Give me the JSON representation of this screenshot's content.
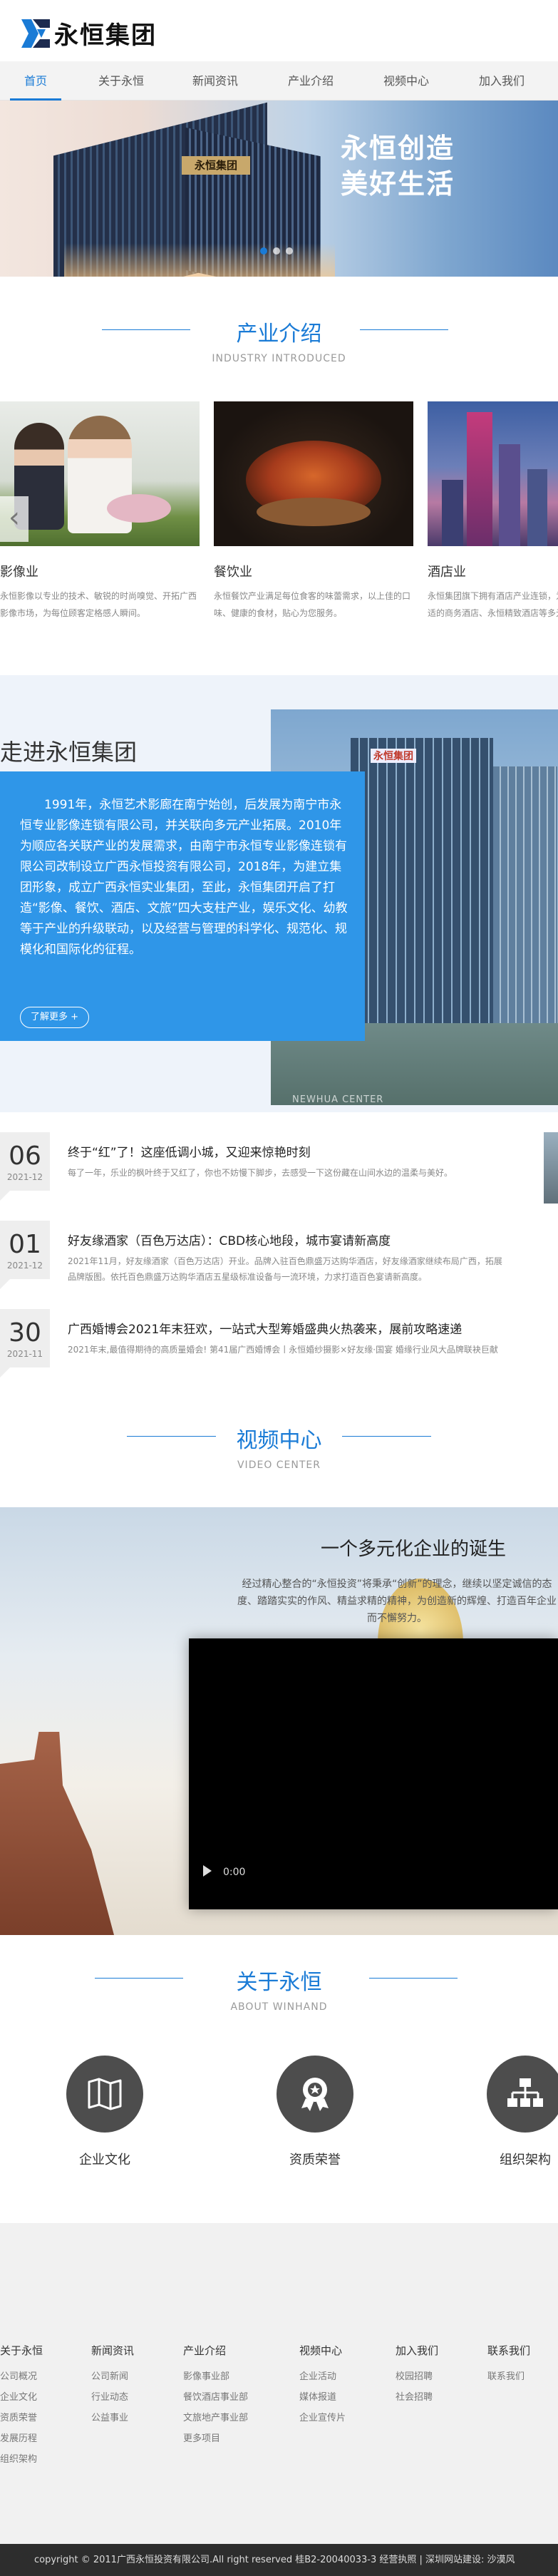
{
  "header": {
    "logo_text": "永恒集团"
  },
  "nav": {
    "items": [
      {
        "label": "首页",
        "active": true
      },
      {
        "label": "关于永恒"
      },
      {
        "label": "新闻资讯"
      },
      {
        "label": "产业介绍"
      },
      {
        "label": "视频中心"
      },
      {
        "label": "加入我们"
      }
    ]
  },
  "banner": {
    "slogan_line1": "永恒创造",
    "slogan_line2": "美好生活",
    "building_sign": "永恒集团",
    "slides": 3,
    "active_slide": 1
  },
  "industry": {
    "title": "产业介绍",
    "subtitle": "INDUSTRY INTRODUCED",
    "items": [
      {
        "name": "影像业",
        "desc": "永恒影像以专业的技术、敏锐的时尚嗅觉、开拓广西影像市场，为每位顾客定格感人瞬间。"
      },
      {
        "name": "餐饮业",
        "desc": "永恒餐饮产业满足每位食客的味蕾需求，以上佳的口味、健康的食材，贴心为您服务。"
      },
      {
        "name": "酒店业",
        "desc": "永恒集团旗下拥有酒店产业连锁，为宾客提供豪华舒适的商务酒店、永恒精致酒店等多元化住宿体验。"
      }
    ],
    "prev_arrow": "‹"
  },
  "intro": {
    "title": "走进永恒集团",
    "text": "1991年，永恒艺术影廊在南宁始创，后发展为南宁市永恒专业影像连锁有限公司，并关联向多元产业拓展。2010年为顺应各关联产业的发展需求，由南宁市永恒专业影像连锁有限公司改制设立广西永恒投资有限公司，2018年，为建立集团形象，成立广西永恒实业集团，至此，永恒集团开启了打造“影像、餐饮、酒店、文旅”四大支柱产业，娱乐文化、幼教等于产业的升级联动，以及经营与管理的科学化、规范化、规模化和国际化的征程。",
    "more": "了解更多 +",
    "photo_caption": "NEWHUA CENTER",
    "building_sign": "永恒集团"
  },
  "news": [
    {
      "day": "06",
      "ym": "2021-12",
      "title": "终于“红”了！这座低调小城，又迎来惊艳时刻",
      "desc": "每了一年，乐业的枫叶终于又红了，你也不妨慢下脚步，去感受一下这份藏在山间水边的温柔与美好。"
    },
    {
      "day": "01",
      "ym": "2021-12",
      "title": "好友缘酒家（百色万达店）：CBD核心地段，城市宴请新高度",
      "desc": "2021年11月，好友缘酒家（百色万达店）开业。品牌入驻百色鼎盛万达购华酒店，好友缘酒家继续布局广西，拓展品牌版图。依托百色鼎盛万达购华酒店五星级标准设备与一流环境，力求打造百色宴请新高度。"
    },
    {
      "day": "30",
      "ym": "2021-11",
      "title": "广西婚博会2021年末狂欢，一站式大型筹婚盛典火热袭来，展前攻略速递",
      "desc": "2021年末,最值得期待的高质量婚会! 第41届广西婚博会丨永恒婚纱摄影×好友缘·国宴 婚缘行业风大品牌联袂巨献"
    }
  ],
  "video": {
    "title": "视频中心",
    "subtitle": "VIDEO CENTER",
    "headline": "一个多元化企业的诞生",
    "desc": "经过精心整合的“永恒投资”将秉承“创新”的理念，继续以坚定诚信的态度、踏踏实实的作风、精益求精的精神，为创造新的辉煌、打造百年企业而不懈努力。",
    "time": "0:00"
  },
  "about": {
    "title": "关于永恒",
    "subtitle": "ABOUT WINHAND",
    "items": [
      {
        "label": "企业文化",
        "icon": "map-icon"
      },
      {
        "label": "资质荣誉",
        "icon": "medal-icon"
      },
      {
        "label": "组织架构",
        "icon": "org-chart-icon"
      }
    ]
  },
  "footer": {
    "columns": [
      {
        "head": "关于永恒",
        "links": [
          "公司概况",
          "企业文化",
          "资质荣誉",
          "发展历程",
          "组织架构"
        ]
      },
      {
        "head": "新闻资讯",
        "links": [
          "公司新闻",
          "行业动态",
          "公益事业"
        ]
      },
      {
        "head": "产业介绍",
        "links": [
          "影像事业部",
          "餐饮酒店事业部",
          "文旅地产事业部",
          "更多项目"
        ]
      },
      {
        "head": "视频中心",
        "links": [
          "企业活动",
          "媒体报道",
          "企业宣传片"
        ]
      },
      {
        "head": "加入我们",
        "links": [
          "校园招聘",
          "社会招聘"
        ]
      },
      {
        "head": "联系我们",
        "links": [
          "联系我们"
        ]
      }
    ],
    "copyright": "copyright © 2011广西永恒投资有限公司.All right reserved   桂B2-20040033-3   经营执照   |   深圳网站建设: 沙漠风"
  },
  "colors": {
    "accent": "#1a7bd6",
    "intro_box": "#2f96e8",
    "footer_bar": "#2d2d2d"
  }
}
